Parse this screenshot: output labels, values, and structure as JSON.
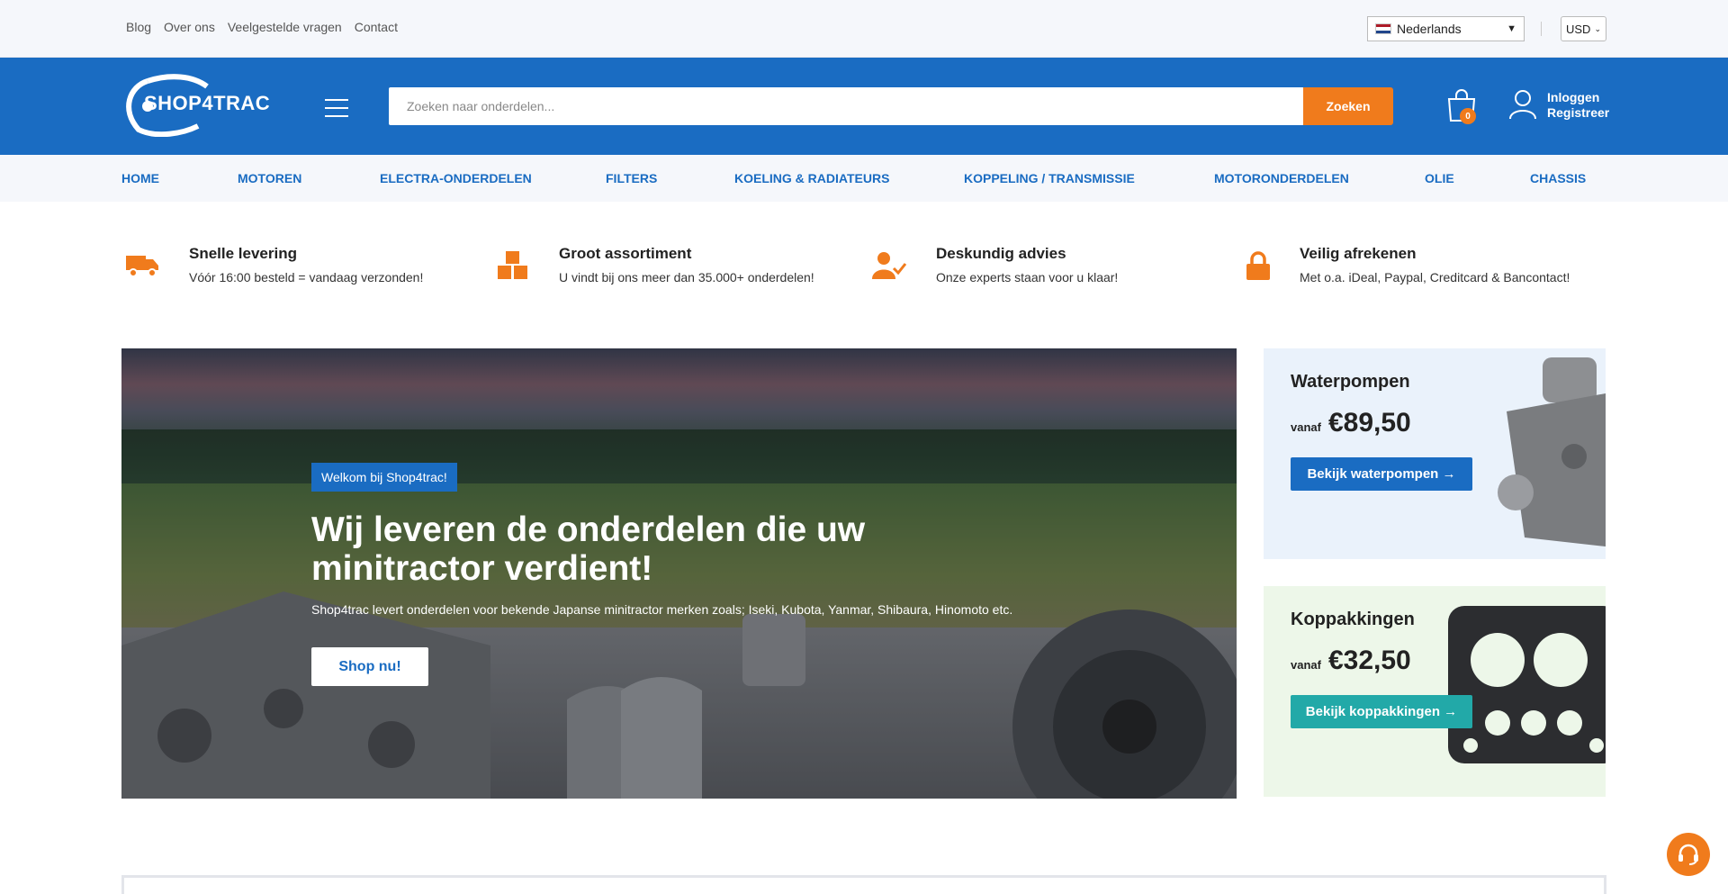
{
  "topbar": {
    "links": [
      "Blog",
      "Over ons",
      "Veelgestelde vragen",
      "Contact"
    ],
    "language": "Nederlands",
    "currency": "USD"
  },
  "header": {
    "logo_text": "SHOP4TRAC",
    "search_placeholder": "Zoeken naar onderdelen...",
    "search_button": "Zoeken",
    "cart_count": "0",
    "login": "Inloggen",
    "register": "Registreer"
  },
  "nav": [
    "HOME",
    "MOTOREN",
    "ELECTRA-ONDERDELEN",
    "FILTERS",
    "KOELING & RADIATEURS",
    "KOPPELING / TRANSMISSIE",
    "MOTORONDERDELEN",
    "OLIE",
    "CHASSIS"
  ],
  "usps": [
    {
      "icon": "truck-icon",
      "title": "Snelle levering",
      "sub": "Vóór 16:00 besteld = vandaag verzonden!"
    },
    {
      "icon": "boxes-icon",
      "title": "Groot assortiment",
      "sub": "U vindt bij ons meer dan 35.000+ onderdelen!"
    },
    {
      "icon": "expert-icon",
      "title": "Deskundig advies",
      "sub": "Onze experts staan voor u klaar!"
    },
    {
      "icon": "lock-icon",
      "title": "Veilig afrekenen",
      "sub": "Met o.a. iDeal, Paypal, Creditcard & Bancontact!"
    }
  ],
  "hero": {
    "badge": "Welkom bij Shop4trac!",
    "title": "Wij leveren de onderdelen die uw minitractor verdient!",
    "sub": "Shop4trac levert onderdelen voor bekende Japanse minitractor merken zoals; Iseki, Kubota, Yanmar, Shibaura, Hinomoto etc.",
    "button": "Shop nu!"
  },
  "promos": [
    {
      "title": "Waterpompen",
      "from": "vanaf",
      "price": "€89,50",
      "button": "Bekijk waterpompen →"
    },
    {
      "title": "Koppakkingen",
      "from": "vanaf",
      "price": "€32,50",
      "button": "Bekijk koppakkingen →"
    }
  ],
  "colors": {
    "brand_blue": "#1a6cc2",
    "accent_orange": "#f07b1c",
    "teal": "#22a9a8"
  }
}
